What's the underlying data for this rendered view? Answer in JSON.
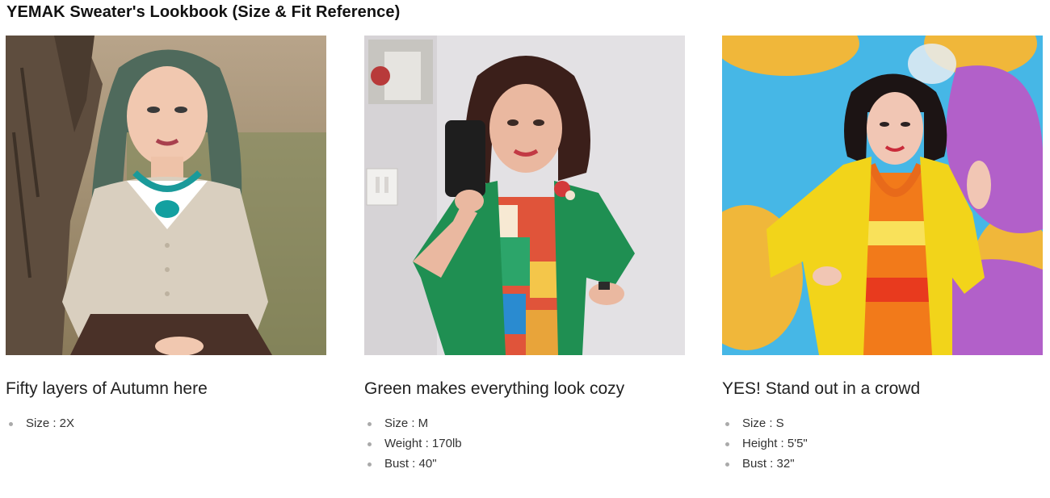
{
  "header": {
    "title": "YEMAK Sweater's Lookbook (Size & Fit Reference)"
  },
  "looks": [
    {
      "caption": "Fifty layers of Autumn here",
      "sweater_color": "#d9cfbf",
      "specs": [
        "Size : 2X"
      ]
    },
    {
      "caption": "Green makes everything look cozy",
      "sweater_color": "#1f8f52",
      "specs": [
        "Size : M",
        "Weight : 170lb",
        "Bust : 40\""
      ]
    },
    {
      "caption": "YES! Stand out in a crowd",
      "sweater_color": "#f2d41a",
      "specs": [
        "Size : S",
        "Height : 5'5\"",
        "Bust : 32\""
      ]
    }
  ]
}
